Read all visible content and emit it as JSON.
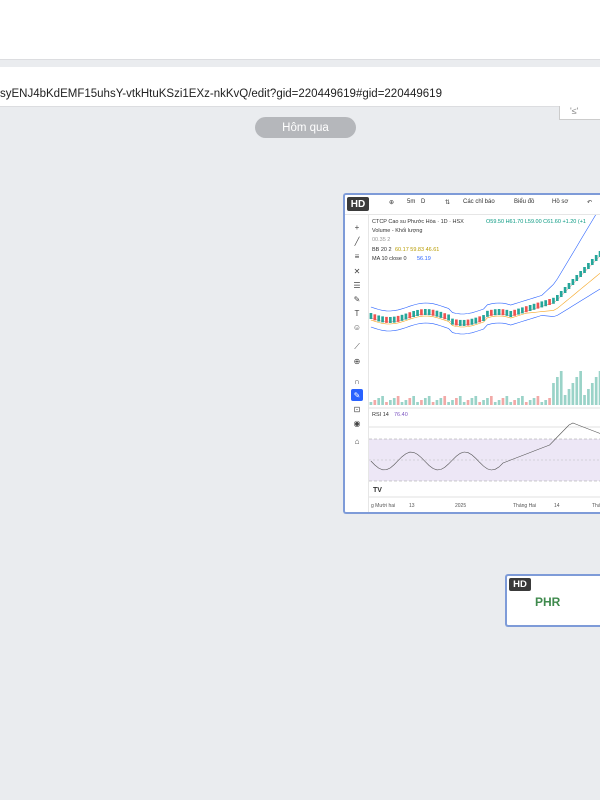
{
  "browser": {
    "url": "syENJ4bKdEMF15uhsY-vtkHtuKSzi1EXz-nkKvQ/edit?gid=220449619#gid=220449619",
    "corner_text": "'≤'"
  },
  "chat": {
    "date_divider": "Hôm qua",
    "image_badge": "HD",
    "second_badge": "HD",
    "ticker": "PHR"
  },
  "tradingview": {
    "toolbar": {
      "plus": "⊕",
      "interval": "5m",
      "interval2": "D",
      "compare": "⇅",
      "indicators": "Các chỉ báo",
      "layout": "Biểu đồ",
      "template": "Hồ sơ"
    },
    "legend": {
      "title": "CTCP Cao su Phước Hòa · 1D · HSX",
      "ohlc": "O59.50 H61.70 L59.00 C61.60 +1.20 (+1",
      "volume": "Volume - Khối lượng",
      "volume_val": "00.35 2",
      "bb": "BB 20 2",
      "bb_vals": "60.17 59.83 46.61",
      "ma": "MA 10 close 0",
      "ma_val": "56.19",
      "rsi": "RSI 14",
      "rsi_val": "76.40"
    },
    "x_axis": [
      "g Mười hai",
      "13",
      "2025",
      "Tháng Hai",
      "14",
      "Tháng"
    ],
    "colors": {
      "up": "#26a69a",
      "down": "#ef5350",
      "bb": "#2962ff",
      "ma": "#f5a623",
      "rsi": "#7e57c2"
    }
  }
}
